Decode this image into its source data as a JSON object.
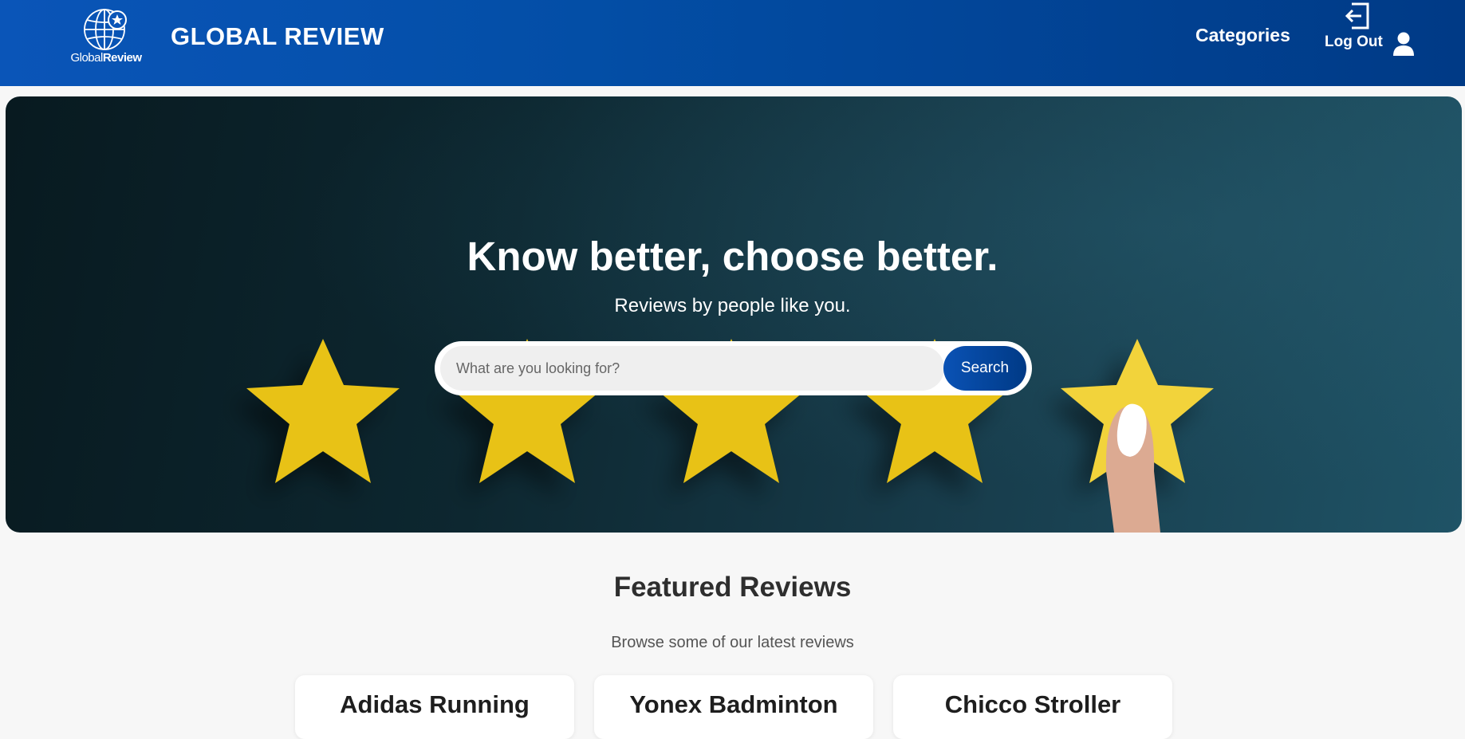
{
  "header": {
    "logo_text_light": "Global",
    "logo_text_bold": "Review",
    "site_title": "GLOBAL REVIEW",
    "nav_categories": "Categories",
    "nav_logout": "Log Out",
    "icons": [
      "globe-logo-icon",
      "logout-icon",
      "user-icon"
    ],
    "colors": {
      "primary": "#034ea6",
      "primary_dark": "#003a86"
    }
  },
  "hero": {
    "title": "Know better, choose better.",
    "subtitle": "Reviews by people like you.",
    "search": {
      "placeholder": "What are you looking for?",
      "value": "",
      "button_label": "Search"
    },
    "star_color": "#e8c214"
  },
  "featured": {
    "title": "Featured Reviews",
    "subtitle": "Browse some of our latest reviews",
    "cards": [
      {
        "title": "Adidas Running"
      },
      {
        "title": "Yonex Badminton"
      },
      {
        "title": "Chicco Stroller"
      }
    ]
  }
}
